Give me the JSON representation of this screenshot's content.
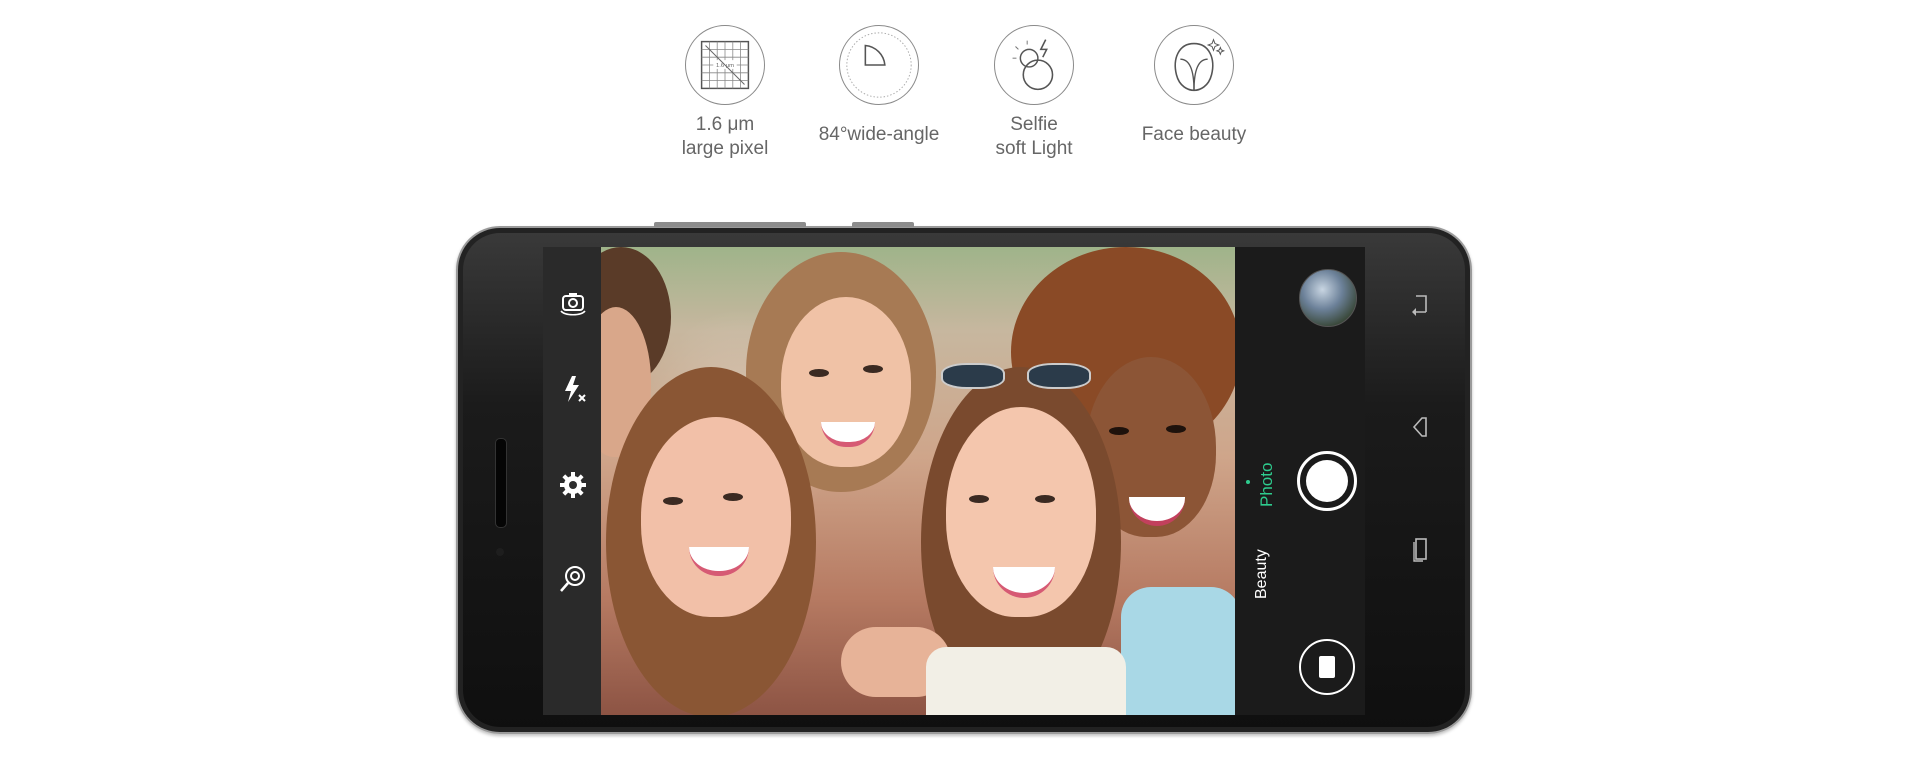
{
  "features": [
    {
      "icon": "pixel-grid-icon",
      "line1": "1.6 μm",
      "line2": "large pixel",
      "badge": "1.6 μm"
    },
    {
      "icon": "wide-angle-icon",
      "line1": "84°wide-angle",
      "line2": ""
    },
    {
      "icon": "selfie-light-icon",
      "line1": "Selfie",
      "line2": "soft Light"
    },
    {
      "icon": "face-beauty-icon",
      "line1": "Face beauty",
      "line2": ""
    }
  ],
  "camera": {
    "left_controls": [
      "switch-camera-icon",
      "flash-off-icon",
      "settings-icon",
      "magic-filter-icon"
    ],
    "modes": {
      "active": "Photo",
      "other": "Beauty"
    },
    "accent_color": "#2ecc8e"
  },
  "nav_keys": [
    "back-icon",
    "home-icon",
    "recent-apps-icon"
  ]
}
